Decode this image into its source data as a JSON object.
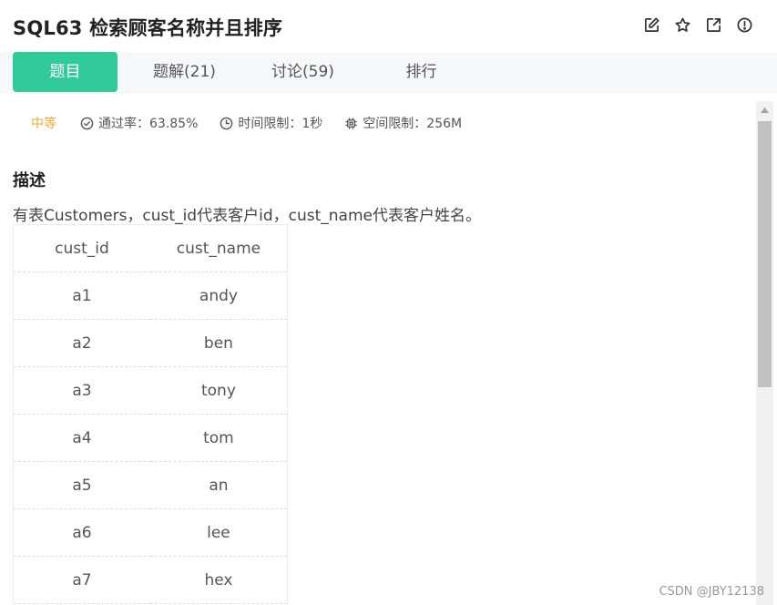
{
  "header": {
    "title": "SQL63  检索顾客名称并且排序",
    "icons": [
      "edit-icon",
      "star-icon",
      "external-link-icon",
      "info-icon"
    ]
  },
  "tabs": [
    {
      "label": "题目",
      "active": true
    },
    {
      "label": "题解(21)",
      "active": false
    },
    {
      "label": "讨论(59)",
      "active": false
    },
    {
      "label": "排行",
      "active": false
    }
  ],
  "meta": {
    "difficulty": "中等",
    "pass_rate": "通过率：63.85%",
    "time_limit": "时间限制：1秒",
    "memory_limit": "空间限制：256M"
  },
  "description": {
    "heading": "描述",
    "text": "有表Customers，cust_id代表客户id，cust_name代表客户姓名。"
  },
  "table": {
    "columns": [
      "cust_id",
      "cust_name"
    ],
    "rows": [
      [
        "a1",
        "andy"
      ],
      [
        "a2",
        "ben"
      ],
      [
        "a3",
        "tony"
      ],
      [
        "a4",
        "tom"
      ],
      [
        "a5",
        "an"
      ],
      [
        "a6",
        "lee"
      ],
      [
        "a7",
        "hex"
      ]
    ]
  },
  "watermark": "CSDN @JBY12138",
  "colors": {
    "accent": "#32ca99",
    "difficulty": "#e8a93a"
  }
}
